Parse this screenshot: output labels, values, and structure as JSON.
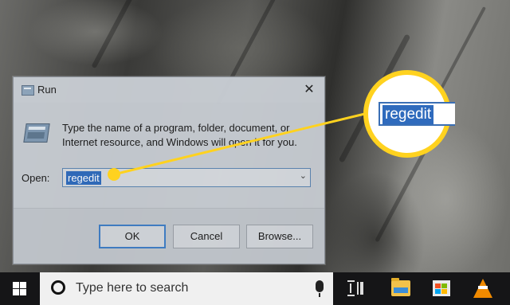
{
  "run_dialog": {
    "title": "Run",
    "instructions": "Type the name of a program, folder, document, or Internet resource, and Windows will open it for you.",
    "open_label": "Open:",
    "open_value": "regedit",
    "buttons": {
      "ok": "OK",
      "cancel": "Cancel",
      "browse": "Browse..."
    },
    "close_glyph": "✕",
    "dropdown_glyph": "⌄"
  },
  "callout": {
    "value": "regedit",
    "color": "#ffd21f"
  },
  "taskbar": {
    "search_placeholder": "Type here to search",
    "icons": [
      "windows-start-icon",
      "cortana-icon",
      "microphone-icon",
      "task-view-icon",
      "file-explorer-icon",
      "microsoft-store-icon",
      "vlc-icon"
    ]
  },
  "colors": {
    "selection": "#2f6bbd",
    "accent": "#3f7ec6",
    "taskbar": "#151517"
  }
}
